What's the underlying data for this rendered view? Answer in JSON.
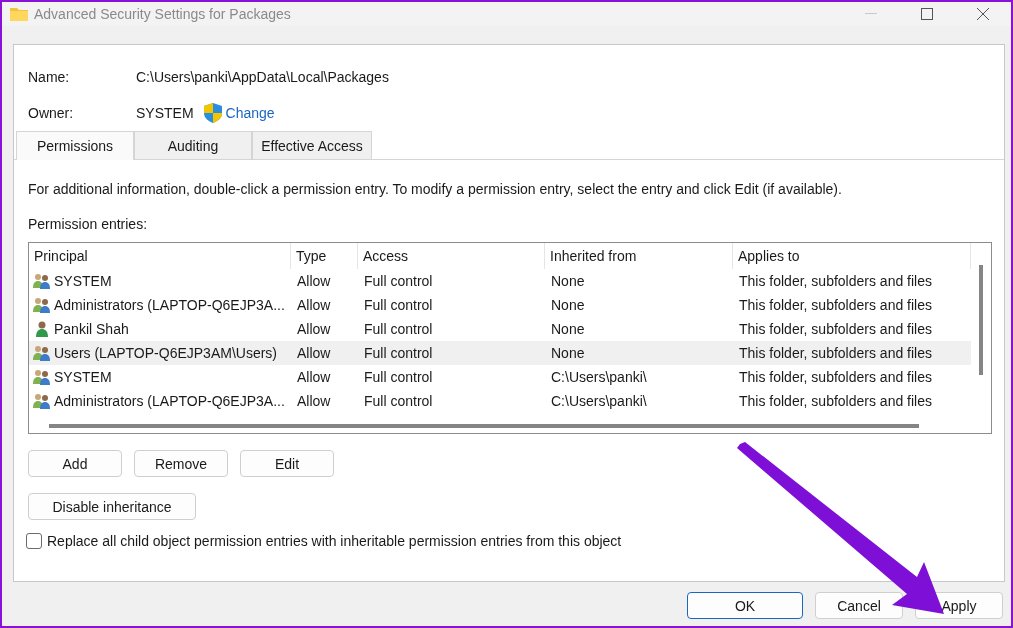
{
  "window": {
    "title": "Advanced Security Settings for Packages"
  },
  "name": {
    "label": "Name:",
    "value": "C:\\Users\\panki\\AppData\\Local\\Packages"
  },
  "owner": {
    "label": "Owner:",
    "value": "SYSTEM",
    "link": "Change"
  },
  "tabs": [
    {
      "label": "Permissions",
      "selected": true
    },
    {
      "label": "Auditing",
      "selected": false
    },
    {
      "label": "Effective Access",
      "selected": false
    }
  ],
  "info": "For additional information, double-click a permission entry. To modify a permission entry, select the entry and click Edit (if available).",
  "entries_label": "Permission entries:",
  "table": {
    "columns": [
      "Principal",
      "Type",
      "Access",
      "Inherited from",
      "Applies to"
    ],
    "rows": [
      {
        "kind": "group",
        "selected": false,
        "cells": [
          "SYSTEM",
          "Allow",
          "Full control",
          "None",
          "This folder, subfolders and files"
        ]
      },
      {
        "kind": "group",
        "selected": false,
        "cells": [
          "Administrators (LAPTOP-Q6EJP3A...",
          "Allow",
          "Full control",
          "None",
          "This folder, subfolders and files"
        ]
      },
      {
        "kind": "user",
        "selected": false,
        "cells": [
          "Pankil Shah",
          "Allow",
          "Full control",
          "None",
          "This folder, subfolders and files"
        ]
      },
      {
        "kind": "group",
        "selected": true,
        "cells": [
          "Users (LAPTOP-Q6EJP3AM\\Users)",
          "Allow",
          "Full control",
          "None",
          "This folder, subfolders and files"
        ]
      },
      {
        "kind": "group",
        "selected": false,
        "cells": [
          "SYSTEM",
          "Allow",
          "Full control",
          "C:\\Users\\panki\\",
          "This folder, subfolders and files"
        ]
      },
      {
        "kind": "group",
        "selected": false,
        "cells": [
          "Administrators (LAPTOP-Q6EJP3A...",
          "Allow",
          "Full control",
          "C:\\Users\\panki\\",
          "This folder, subfolders and files"
        ]
      }
    ]
  },
  "entry_buttons": [
    "Add",
    "Remove",
    "Edit"
  ],
  "inheritance_button": "Disable inheritance",
  "replace_checkbox": {
    "label": "Replace all child object permission entries with inheritable permission entries from this object",
    "checked": false
  },
  "dialog_buttons": [
    {
      "label": "OK",
      "default": true
    },
    {
      "label": "Cancel",
      "default": false
    },
    {
      "label": "Apply",
      "default": false
    }
  ]
}
